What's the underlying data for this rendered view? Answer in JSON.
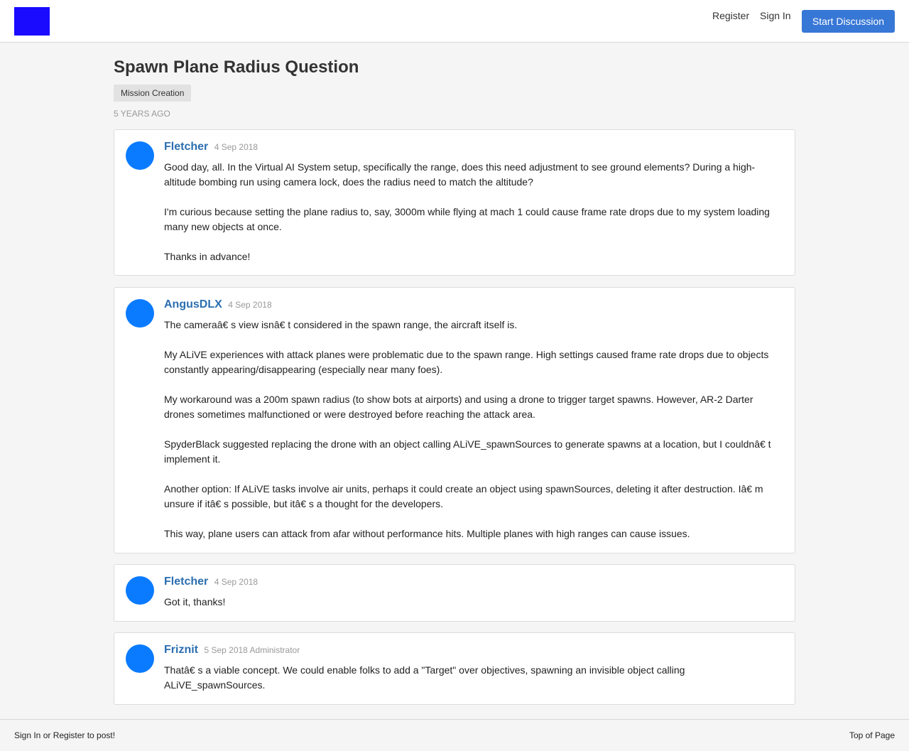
{
  "header": {
    "register_label": "Register",
    "signin_label": "Sign In",
    "start_discussion_label": "Start Discussion",
    "logo_color": "#1a0bff"
  },
  "discussion": {
    "title": "Spawn Plane Radius Question",
    "tag": "Mission Creation",
    "age": "5 YEARS AGO"
  },
  "posts": [
    {
      "author": "Fletcher",
      "meta": "4 Sep 2018",
      "paragraphs": [
        "Good day, all. In the Virtual AI System setup, specifically the range, does this need adjustment to see ground elements? During a high-altitude bombing run using camera lock, does the radius need to match the altitude?",
        "I'm curious because setting the plane radius to, say, 3000m while flying at mach 1 could cause frame rate drops due to my system loading many new objects at once.",
        "Thanks in advance!"
      ]
    },
    {
      "author": "AngusDLX",
      "meta": "4 Sep 2018",
      "paragraphs": [
        "The cameraâ€ s view isnâ€ t considered in the spawn range, the aircraft itself is.",
        "My ALiVE experiences with attack planes were problematic due to the spawn range. High settings caused frame rate drops due to objects constantly appearing/disappearing (especially near many foes).",
        "My workaround was a 200m spawn radius (to show bots at airports) and using a drone to trigger target spawns. However, AR-2 Darter drones sometimes malfunctioned or were destroyed before reaching the attack area.",
        "SpyderBlack suggested replacing the drone with an object calling ALiVE_spawnSources to generate spawns at a location, but I couldnâ€ t implement it.",
        "Another option: If ALiVE tasks involve air units, perhaps it could create an object using spawnSources, deleting it after destruction. Iâ€ m unsure if itâ€ s possible, but itâ€ s a thought for the developers.",
        "This way, plane users can attack from afar without performance hits. Multiple planes with high ranges can cause issues."
      ]
    },
    {
      "author": "Fletcher",
      "meta": "4 Sep 2018",
      "paragraphs": [
        "Got it, thanks!"
      ]
    },
    {
      "author": "Friznit",
      "meta": "5 Sep 2018 Administrator",
      "paragraphs": [
        "Thatâ€ s a viable concept. We could enable folks to add a \"Target\" over objectives, spawning an invisible object calling ALiVE_spawnSources."
      ]
    }
  ],
  "footer": {
    "left_label": "Sign In or Register to post!",
    "right_label": "Top of Page"
  },
  "colors": {
    "accent": "#3777d6",
    "author_link": "#2b6eb0",
    "avatar": "#0a7bff"
  }
}
